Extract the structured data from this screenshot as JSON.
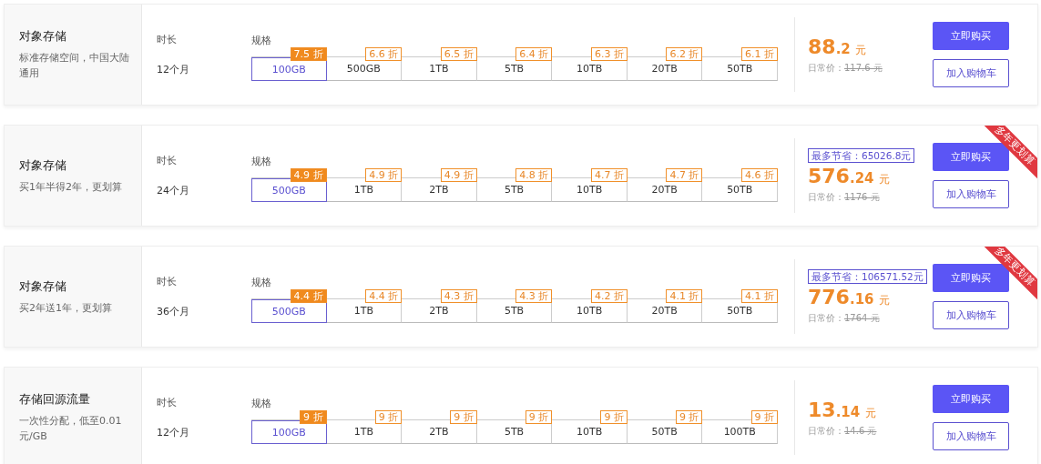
{
  "products": [
    {
      "title": "对象存储",
      "description": "标准存储空间，中国大陆通用",
      "duration_label": "时长",
      "duration": "12个月",
      "spec_label": "规格",
      "specs": [
        {
          "label": "100GB",
          "discount": "7.5 折",
          "selected": true
        },
        {
          "label": "500GB",
          "discount": "6.6 折",
          "selected": false
        },
        {
          "label": "1TB",
          "discount": "6.5 折",
          "selected": false
        },
        {
          "label": "5TB",
          "discount": "6.4 折",
          "selected": false
        },
        {
          "label": "10TB",
          "discount": "6.3 折",
          "selected": false
        },
        {
          "label": "20TB",
          "discount": "6.2 折",
          "selected": false
        },
        {
          "label": "50TB",
          "discount": "6.1 折",
          "selected": false
        }
      ],
      "price_integer": "88",
      "price_decimal": ".2",
      "currency": "元",
      "regular_label": "日常价：",
      "regular_price": "117.6 元",
      "buy_button": "立即购买",
      "cart_button": "加入购物车"
    },
    {
      "title": "对象存储",
      "description": "买1年半得2年，更划算",
      "duration_label": "时长",
      "duration": "24个月",
      "spec_label": "规格",
      "specs": [
        {
          "label": "500GB",
          "discount": "4.9 折",
          "selected": true
        },
        {
          "label": "1TB",
          "discount": "4.9 折",
          "selected": false
        },
        {
          "label": "2TB",
          "discount": "4.9 折",
          "selected": false
        },
        {
          "label": "5TB",
          "discount": "4.8 折",
          "selected": false
        },
        {
          "label": "10TB",
          "discount": "4.7 折",
          "selected": false
        },
        {
          "label": "20TB",
          "discount": "4.7 折",
          "selected": false
        },
        {
          "label": "50TB",
          "discount": "4.6 折",
          "selected": false
        }
      ],
      "savings": "最多节省：65026.8元",
      "price_integer": "576",
      "price_decimal": ".24",
      "currency": "元",
      "regular_label": "日常价：",
      "regular_price": "1176 元",
      "ribbon": "多年更划算",
      "buy_button": "立即购买",
      "cart_button": "加入购物车"
    },
    {
      "title": "对象存储",
      "description": "买2年送1年，更划算",
      "duration_label": "时长",
      "duration": "36个月",
      "spec_label": "规格",
      "specs": [
        {
          "label": "500GB",
          "discount": "4.4 折",
          "selected": true
        },
        {
          "label": "1TB",
          "discount": "4.4 折",
          "selected": false
        },
        {
          "label": "2TB",
          "discount": "4.3 折",
          "selected": false
        },
        {
          "label": "5TB",
          "discount": "4.3 折",
          "selected": false
        },
        {
          "label": "10TB",
          "discount": "4.2 折",
          "selected": false
        },
        {
          "label": "20TB",
          "discount": "4.1 折",
          "selected": false
        },
        {
          "label": "50TB",
          "discount": "4.1 折",
          "selected": false
        }
      ],
      "savings": "最多节省：106571.52元",
      "price_integer": "776",
      "price_decimal": ".16",
      "currency": "元",
      "regular_label": "日常价：",
      "regular_price": "1764 元",
      "ribbon": "多年更划算",
      "buy_button": "立即购买",
      "cart_button": "加入购物车"
    },
    {
      "title": "存储回源流量",
      "description": "一次性分配，低至0.01元/GB",
      "duration_label": "时长",
      "duration": "12个月",
      "spec_label": "规格",
      "specs": [
        {
          "label": "100GB",
          "discount": "9 折",
          "selected": true
        },
        {
          "label": "1TB",
          "discount": "9 折",
          "selected": false
        },
        {
          "label": "2TB",
          "discount": "9 折",
          "selected": false
        },
        {
          "label": "5TB",
          "discount": "9 折",
          "selected": false
        },
        {
          "label": "10TB",
          "discount": "9 折",
          "selected": false
        },
        {
          "label": "50TB",
          "discount": "9 折",
          "selected": false
        },
        {
          "label": "100TB",
          "discount": "9 折",
          "selected": false
        }
      ],
      "price_integer": "13",
      "price_decimal": ".14",
      "currency": "元",
      "regular_label": "日常价：",
      "regular_price": "14.6 元",
      "buy_button": "立即购买",
      "cart_button": "加入购物车"
    }
  ]
}
